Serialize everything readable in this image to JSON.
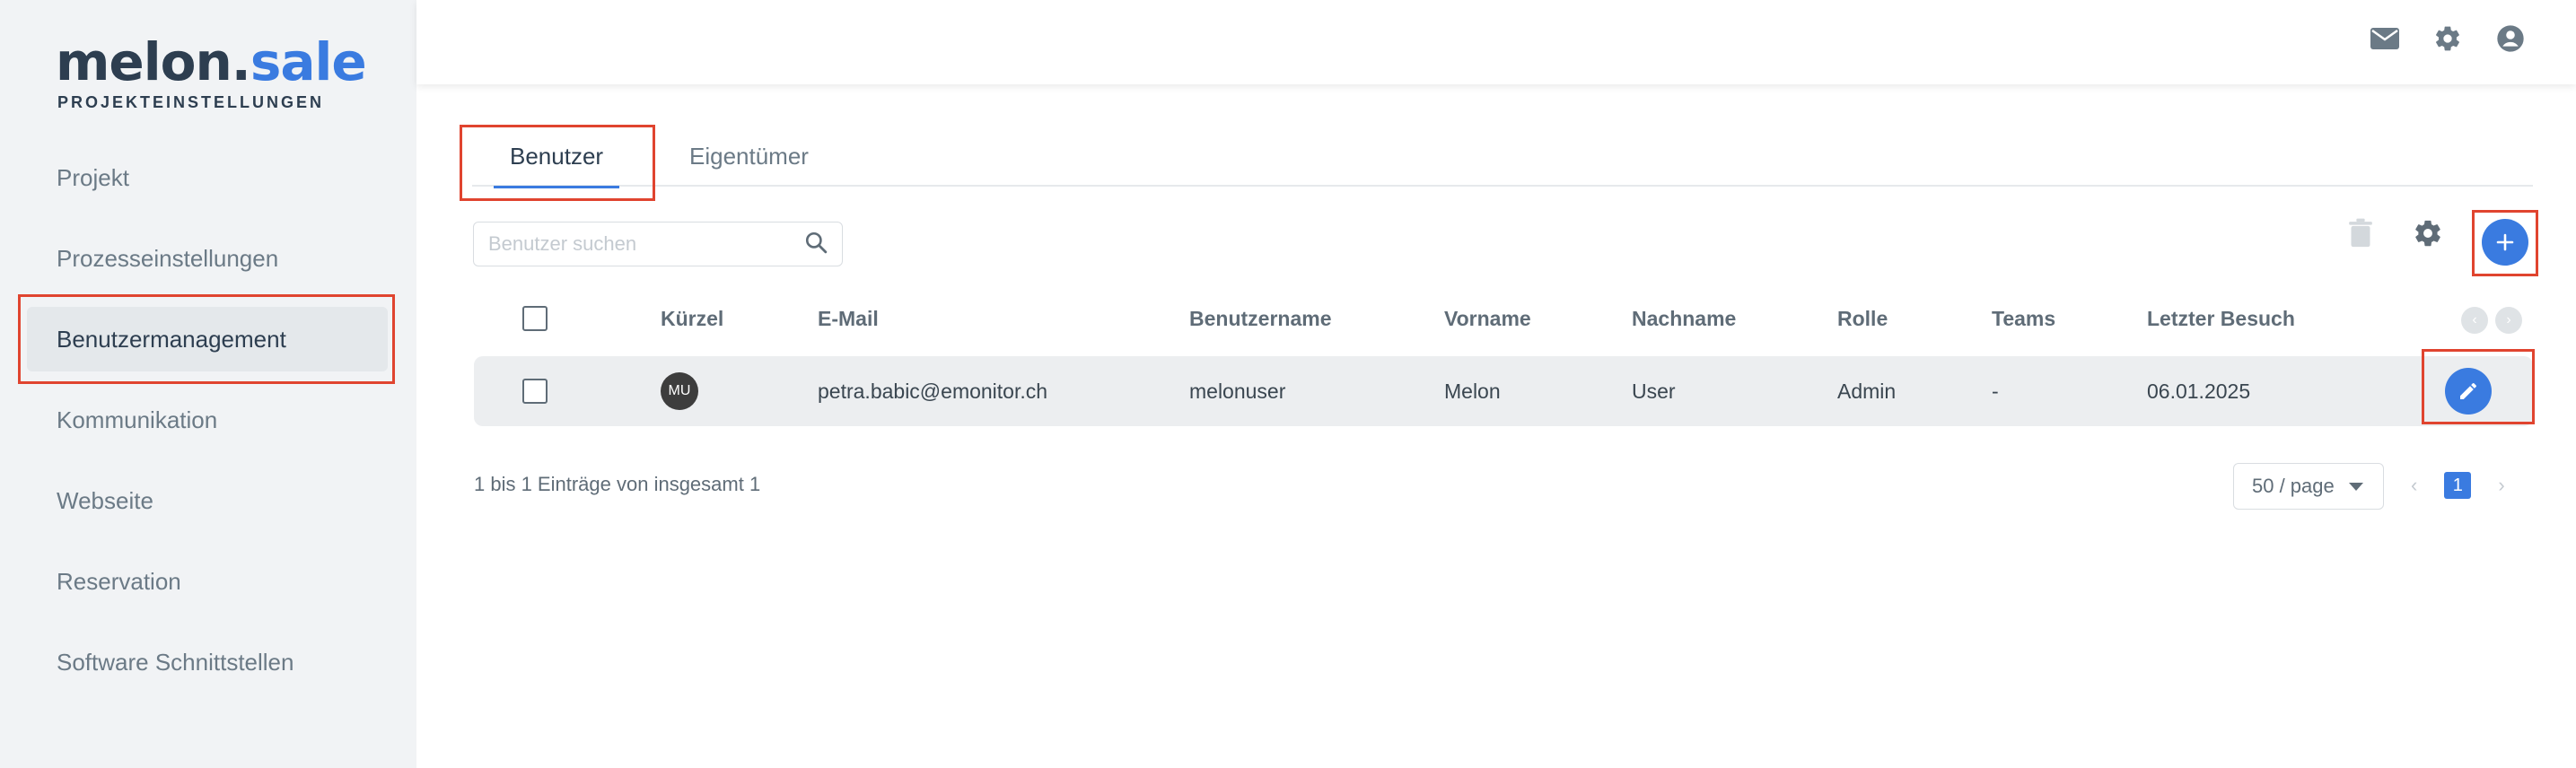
{
  "logo": {
    "main": "melon.",
    "accent": "sale",
    "subtitle": "PROJEKTEINSTELLUNGEN"
  },
  "sidebar": {
    "items": [
      {
        "label": "Projekt"
      },
      {
        "label": "Prozesseinstellungen"
      },
      {
        "label": "Benutzermanagement",
        "active": true
      },
      {
        "label": "Kommunikation"
      },
      {
        "label": "Webseite"
      },
      {
        "label": "Reservation"
      },
      {
        "label": "Software Schnittstellen"
      }
    ]
  },
  "header": {
    "icons": [
      "mail-icon",
      "gear-icon",
      "user-circle-icon"
    ]
  },
  "tabs": [
    {
      "label": "Benutzer",
      "active": true
    },
    {
      "label": "Eigentümer"
    }
  ],
  "search": {
    "placeholder": "Benutzer suchen",
    "value": ""
  },
  "toolbar": {
    "icons": [
      "trash-icon",
      "gear-icon",
      "plus-icon"
    ]
  },
  "table": {
    "columns": [
      "Kürzel",
      "E-Mail",
      "Benutzername",
      "Vorname",
      "Nachname",
      "Rolle",
      "Teams",
      "Letzter Besuch"
    ],
    "rows": [
      {
        "initials": "MU",
        "email": "petra.babic@emonitor.ch",
        "username": "melonuser",
        "firstname": "Melon",
        "lastname": "User",
        "role": "Admin",
        "teams": "-",
        "last_visit": "06.01.2025"
      }
    ]
  },
  "footer": {
    "summary": "1 bis 1 Einträge von insgesamt 1",
    "page_size": "50 / page",
    "current_page": "1"
  },
  "colors": {
    "accent": "#3a7be0",
    "highlight": "#e0442f",
    "sidebar_bg": "#f1f3f5"
  }
}
